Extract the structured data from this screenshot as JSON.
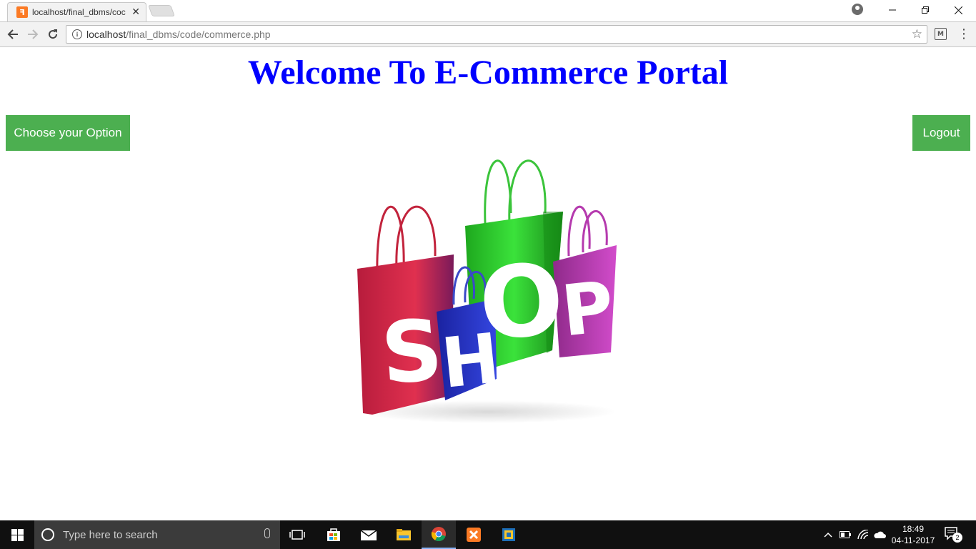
{
  "browser": {
    "tab_title": "localhost/final_dbms/coc",
    "url_host": "localhost",
    "url_path": "/final_dbms/code/commerce.php"
  },
  "page": {
    "title": "Welcome To E-Commerce Portal",
    "option_button": "Choose your Option",
    "logout_button": "Logout",
    "image_letters": [
      "S",
      "H",
      "O",
      "P"
    ],
    "colors": {
      "title": "#0000ff",
      "button": "#4caf50",
      "bag_red": "#d6284a",
      "bag_green": "#2ecc2e",
      "bag_blue": "#2433c9",
      "bag_magenta": "#c037b8"
    }
  },
  "taskbar": {
    "search_placeholder": "Type here to search",
    "time": "18:49",
    "date": "04-11-2017",
    "notification_count": "2"
  }
}
